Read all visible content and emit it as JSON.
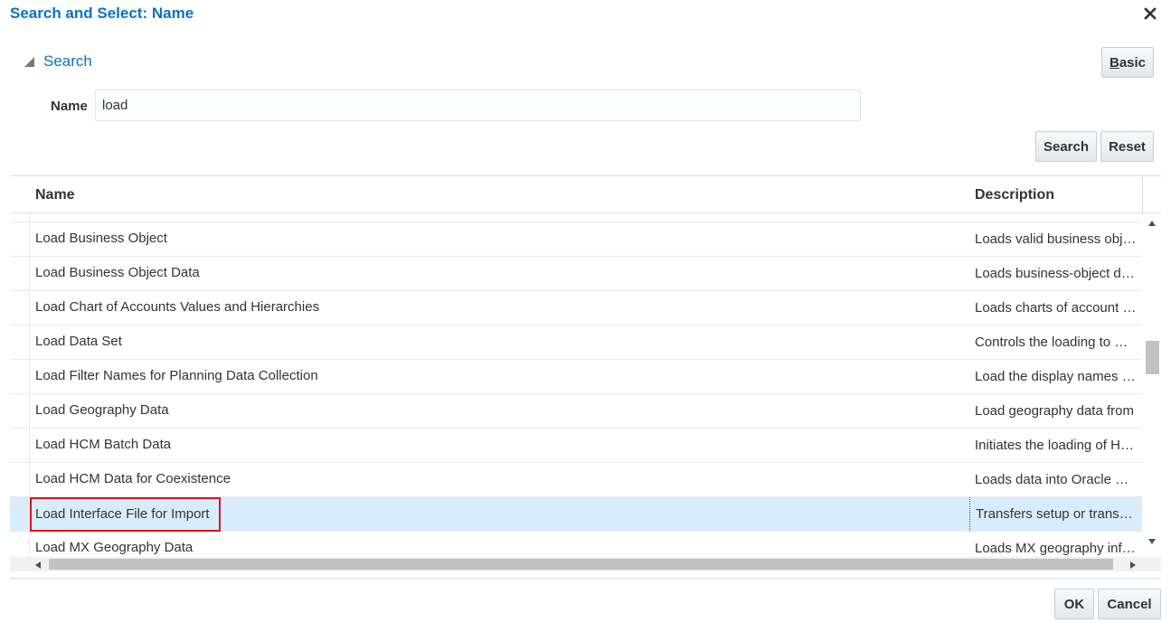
{
  "dialog": {
    "title": "Search and Select: Name",
    "close_icon": "close-icon"
  },
  "search_panel": {
    "header_label": "Search",
    "disclosure_icon": "triangle-down-icon",
    "basic_button_accesskey": "B",
    "basic_button_rest": "asic",
    "name_label": "Name",
    "name_value": "load",
    "search_button": "Search",
    "reset_button": "Reset"
  },
  "results_table": {
    "columns": {
      "name": "Name",
      "description": "Description"
    },
    "rows": [
      {
        "name": "Load Business Object",
        "description": "Loads valid business objects"
      },
      {
        "name": "Load Business Object Data",
        "description": "Loads business-object data"
      },
      {
        "name": "Load Chart of Accounts Values and Hierarchies",
        "description": "Loads charts of account values"
      },
      {
        "name": "Load Data Set",
        "description": "Controls the loading to Oracle"
      },
      {
        "name": "Load Filter Names for Planning Data Collection",
        "description": "Load the display names for"
      },
      {
        "name": "Load Geography Data",
        "description": "Load geography data from"
      },
      {
        "name": "Load HCM Batch Data",
        "description": "Initiates the loading of HCM"
      },
      {
        "name": "Load HCM Data for Coexistence",
        "description": "Loads data into Oracle Fusion"
      },
      {
        "name": "Load Interface File for Import",
        "description": "Transfers setup or transaction"
      },
      {
        "name": "Load MX Geography Data",
        "description": "Loads MX geography information"
      }
    ],
    "selected_row_index": 8,
    "vertical_scroll_position": 0.4
  },
  "footer": {
    "ok_button": "OK",
    "cancel_button": "Cancel"
  },
  "colors": {
    "title_blue": "#0572ce",
    "selected_row": "#d9ecfb",
    "highlight_outline": "#e0101e"
  }
}
